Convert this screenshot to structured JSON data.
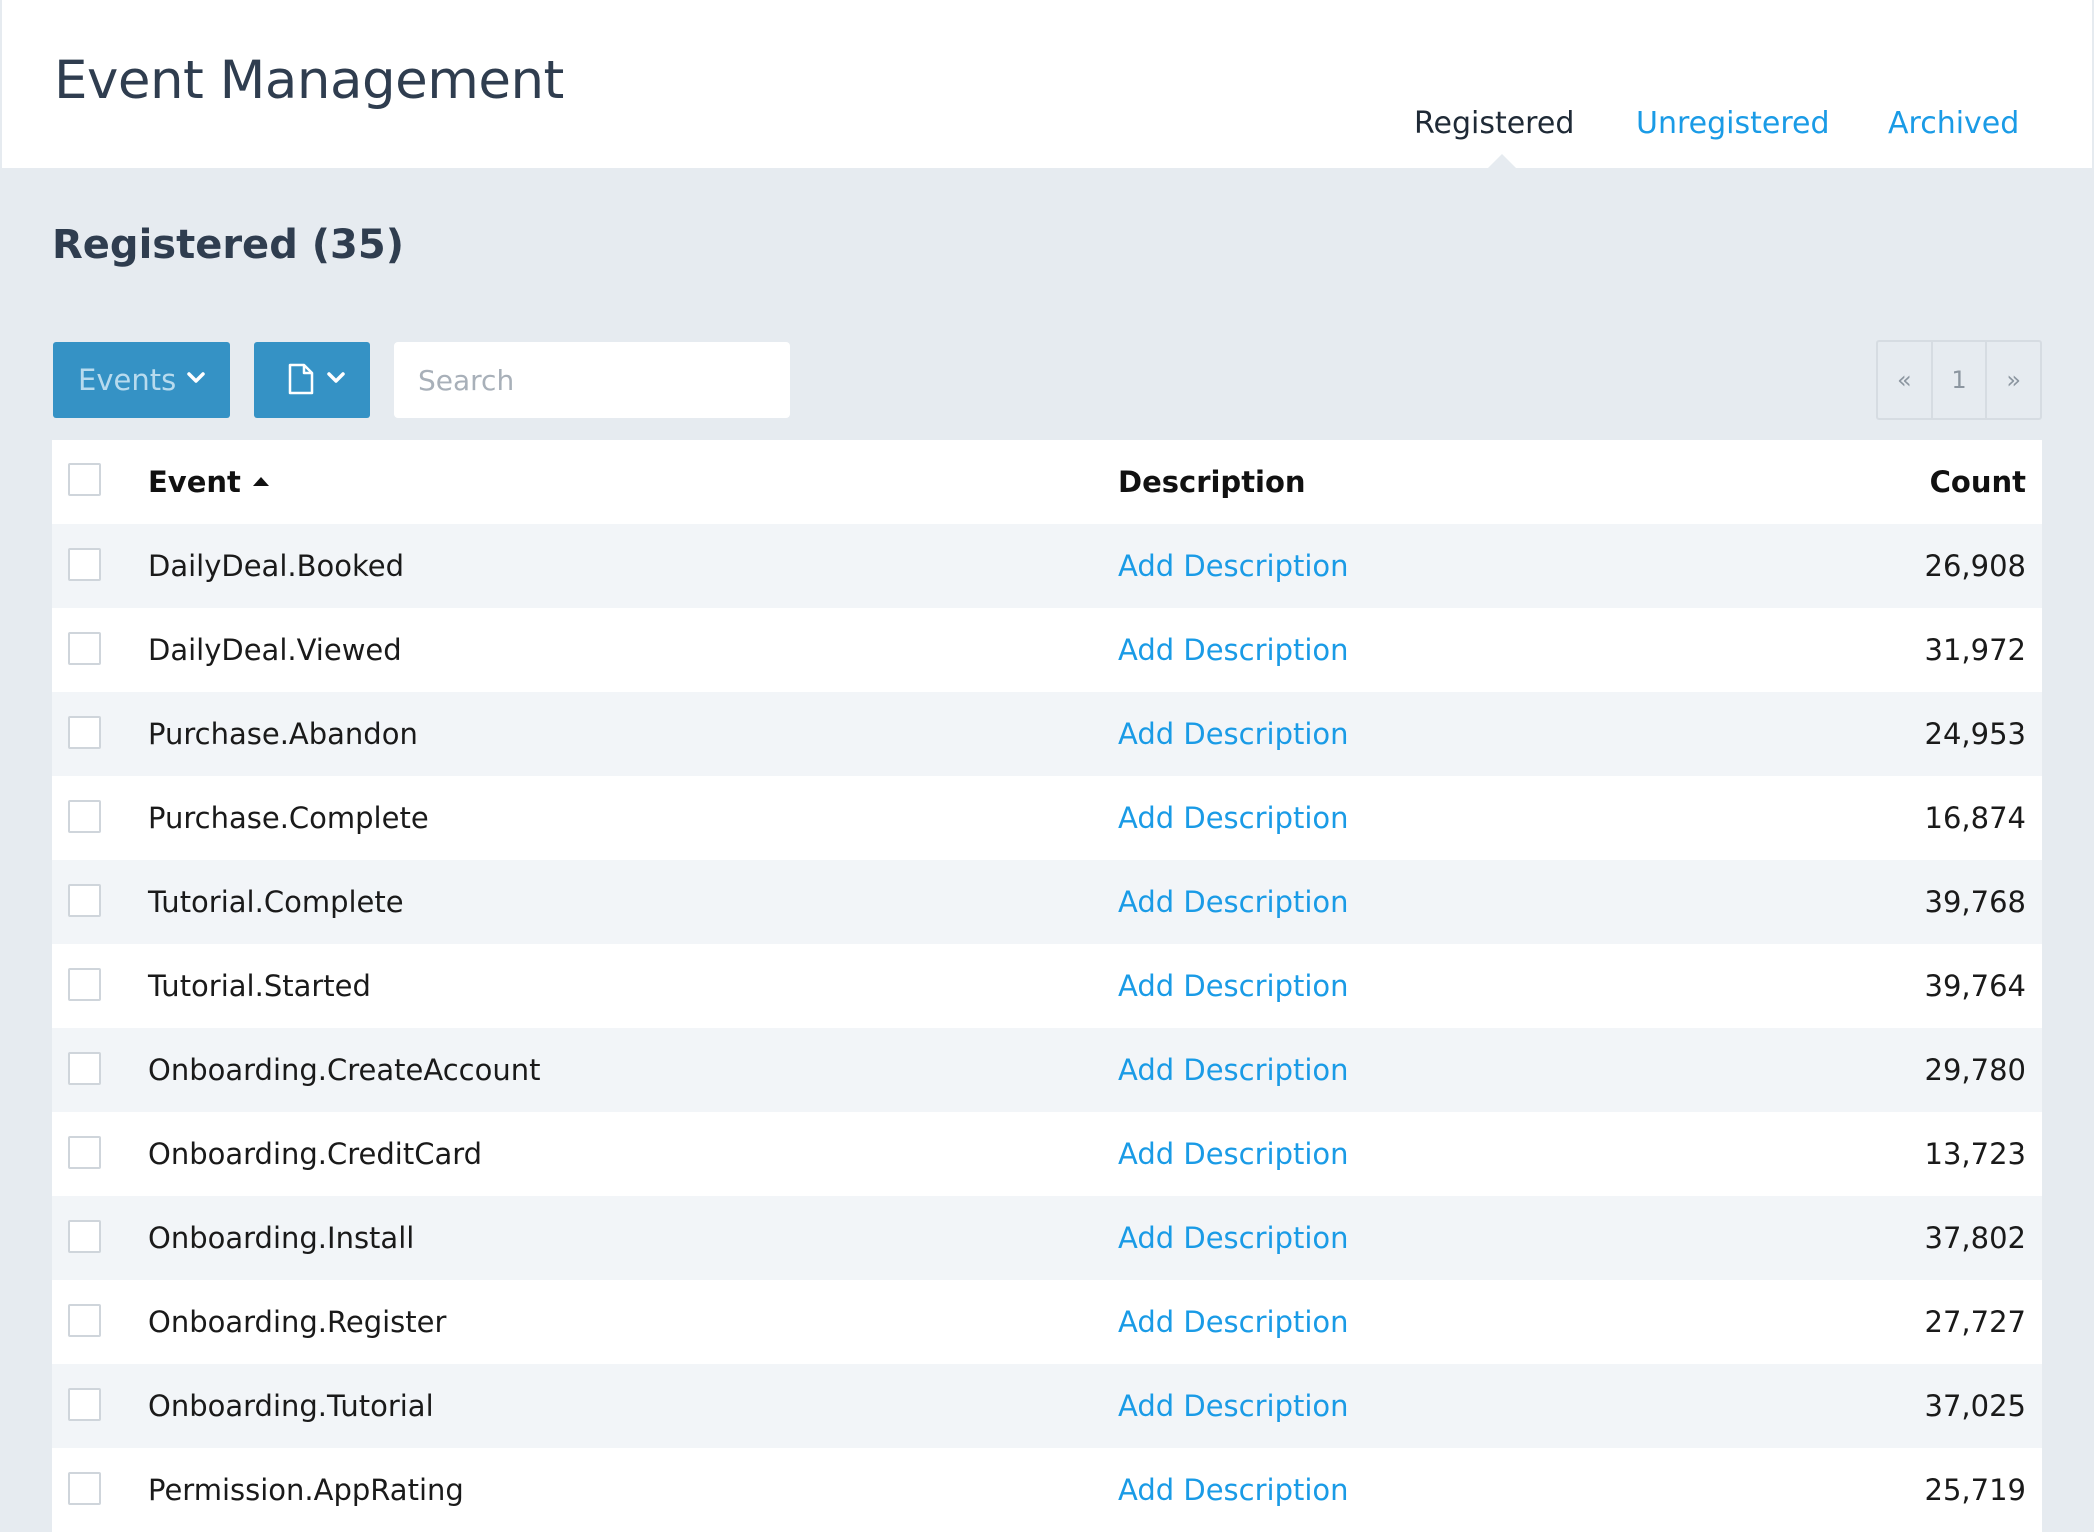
{
  "header": {
    "title": "Event Management",
    "tabs": [
      {
        "label": "Registered",
        "active": true
      },
      {
        "label": "Unregistered",
        "active": false
      },
      {
        "label": "Archived",
        "active": false
      }
    ]
  },
  "section": {
    "title": "Registered (35)"
  },
  "toolbar": {
    "events_label": "Events",
    "search_placeholder": "Search",
    "pager": {
      "prev": "«",
      "page": "1",
      "next": "»"
    }
  },
  "table": {
    "columns": {
      "event": "Event",
      "description": "Description",
      "count": "Count"
    },
    "rows": [
      {
        "event": "DailyDeal.Booked",
        "description": "Add Description",
        "count": "26,908"
      },
      {
        "event": "DailyDeal.Viewed",
        "description": "Add Description",
        "count": "31,972"
      },
      {
        "event": "Purchase.Abandon",
        "description": "Add Description",
        "count": "24,953"
      },
      {
        "event": "Purchase.Complete",
        "description": "Add Description",
        "count": "16,874"
      },
      {
        "event": "Tutorial.Complete",
        "description": "Add Description",
        "count": "39,768"
      },
      {
        "event": "Tutorial.Started",
        "description": "Add Description",
        "count": "39,764"
      },
      {
        "event": "Onboarding.CreateAccount",
        "description": "Add Description",
        "count": "29,780"
      },
      {
        "event": "Onboarding.CreditCard",
        "description": "Add Description",
        "count": "13,723"
      },
      {
        "event": "Onboarding.Install",
        "description": "Add Description",
        "count": "37,802"
      },
      {
        "event": "Onboarding.Register",
        "description": "Add Description",
        "count": "27,727"
      },
      {
        "event": "Onboarding.Tutorial",
        "description": "Add Description",
        "count": "37,025"
      },
      {
        "event": "Permission.AppRating",
        "description": "Add Description",
        "count": "25,719"
      }
    ]
  }
}
